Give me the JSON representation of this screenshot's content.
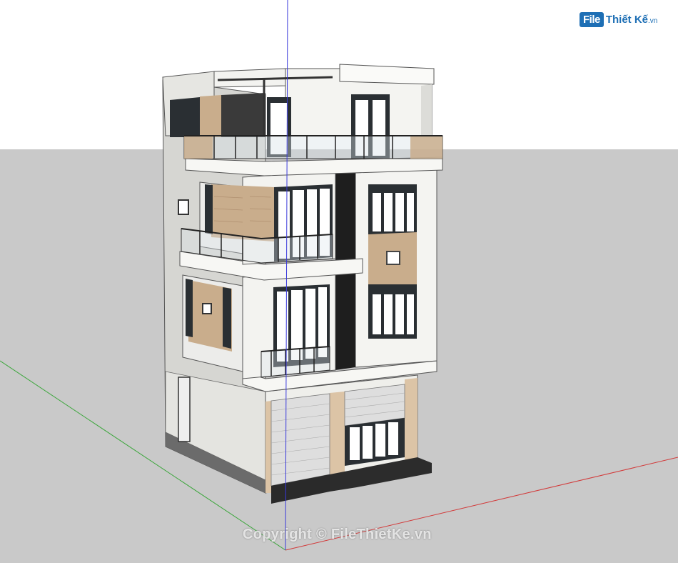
{
  "watermark": {
    "logo_box": "File",
    "logo_text": "Thiết Kế",
    "logo_suffix": ".vn",
    "copyright": "Copyright © FileThietKe.vn"
  },
  "colors": {
    "sky": "#ffffff",
    "ground": "#c9c9c9",
    "axis_blue": "#3a3adb",
    "axis_red": "#d23a3a",
    "axis_green": "#3aa63a",
    "wall": "#f1f1ee",
    "wall_shade": "#d9d9d5",
    "wood": "#c9ad8c",
    "stone": "#dcc4a6",
    "frame": "#2a2f33",
    "glass": "#ffffff"
  }
}
